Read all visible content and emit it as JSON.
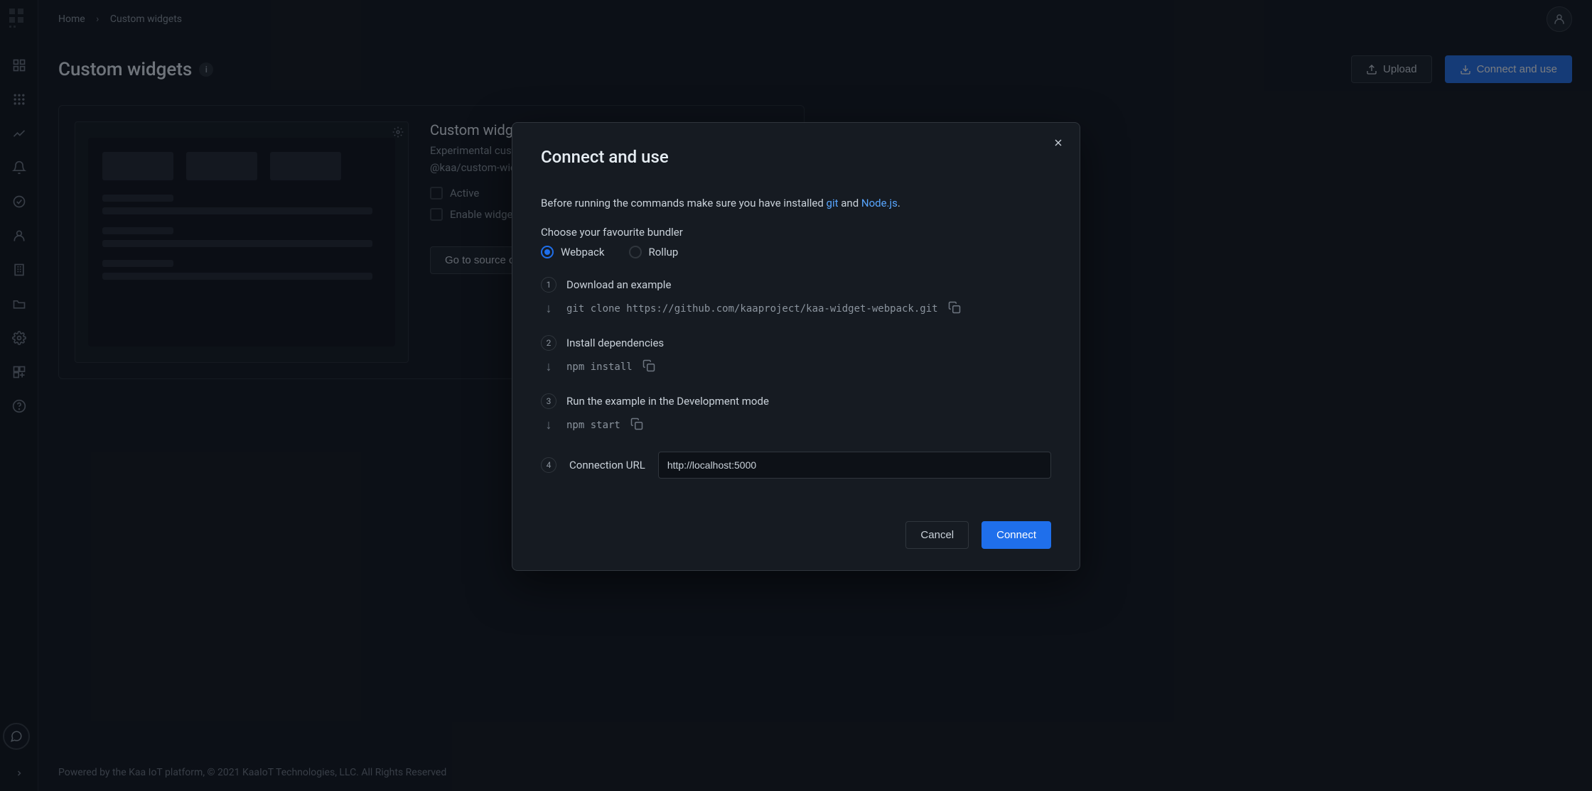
{
  "breadcrumb": {
    "home": "Home",
    "current": "Custom widgets"
  },
  "page": {
    "title": "Custom widgets",
    "info_badge": "i"
  },
  "header_actions": {
    "upload": "Upload",
    "connect_and_use": "Connect and use"
  },
  "card": {
    "title": "Custom widget",
    "desc": "Experimental custom widget",
    "sub": "@kaa/custom-widgets",
    "active": "Active",
    "enable_config": "Enable widget configuration",
    "go_to_source": "Go to source code"
  },
  "modal": {
    "title": "Connect and use",
    "intro_before": "Before running the commands make sure you have installed ",
    "git": "git",
    "intro_and": " and ",
    "node": "Node.js",
    "intro_period": ".",
    "choose_bundler": "Choose your favourite bundler",
    "webpack": "Webpack",
    "rollup": "Rollup",
    "step1_label": "Download an example",
    "step1_code": "git clone https://github.com/kaaproject/kaa-widget-webpack.git",
    "step2_label": "Install dependencies",
    "step2_code": "npm install",
    "step3_label": "Run the example in the Development mode",
    "step3_code": "npm start",
    "step4_label": "Connection URL",
    "url_value": "http://localhost:5000",
    "cancel": "Cancel",
    "connect": "Connect",
    "step_nums": {
      "one": "1",
      "two": "2",
      "three": "3",
      "four": "4"
    }
  },
  "footer": "Powered by the Kaa IoT platform, © 2021 KaaIoT Technologies, LLC. All Rights Reserved"
}
